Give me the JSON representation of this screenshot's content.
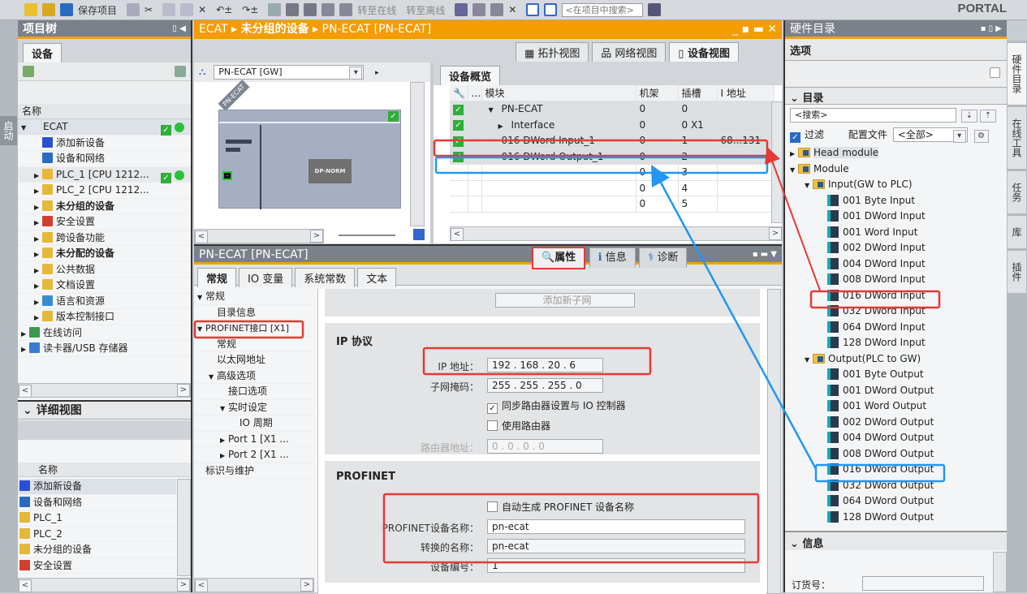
{
  "toolbar": {
    "save_label": "保存项目",
    "go_online": "转至在线",
    "go_offline": "转至离线",
    "search_placeholder": "<在项目中搜索>",
    "brand": "PORTAL"
  },
  "left_strip": {
    "label": "启动"
  },
  "project_tree": {
    "title": "项目树",
    "tab": "设备",
    "col_name": "名称",
    "items": [
      {
        "label": "ECAT",
        "level": 0,
        "fold": "▼",
        "bold": false,
        "check": true,
        "icon": "project-icon"
      },
      {
        "label": "添加新设备",
        "level": 1,
        "fold": "",
        "icon": "add-device-icon"
      },
      {
        "label": "设备和网络",
        "level": 1,
        "fold": "",
        "icon": "network-icon"
      },
      {
        "label": "PLC_1 [CPU 1212...",
        "level": 1,
        "fold": "▶",
        "check": true,
        "icon": "plc-icon"
      },
      {
        "label": "PLC_2 [CPU 1212...",
        "level": 1,
        "fold": "▶",
        "icon": "plc-icon"
      },
      {
        "label": "未分组的设备",
        "level": 1,
        "fold": "▶",
        "bold": true,
        "icon": "ungrouped-devices-icon"
      },
      {
        "label": "安全设置",
        "level": 1,
        "fold": "▶",
        "icon": "security-icon"
      },
      {
        "label": "跨设备功能",
        "level": 1,
        "fold": "▶",
        "icon": "cross-device-icon"
      },
      {
        "label": "未分配的设备",
        "level": 1,
        "fold": "▶",
        "bold": true,
        "icon": "unassigned-devices-icon"
      },
      {
        "label": "公共数据",
        "level": 1,
        "fold": "▶",
        "icon": "common-data-icon"
      },
      {
        "label": "文档设置",
        "level": 1,
        "fold": "▶",
        "icon": "document-settings-icon"
      },
      {
        "label": "语言和资源",
        "level": 1,
        "fold": "▶",
        "icon": "language-icon"
      },
      {
        "label": "版本控制接口",
        "level": 1,
        "fold": "▶",
        "icon": "version-control-icon"
      },
      {
        "label": "在线访问",
        "level": 0,
        "fold": "▶",
        "icon": "online-access-icon"
      },
      {
        "label": "读卡器/USB 存储器",
        "level": 0,
        "fold": "▶",
        "icon": "card-reader-icon"
      }
    ]
  },
  "detail_view": {
    "title": "详细视图",
    "col_name": "名称",
    "items": [
      "添加新设备",
      "设备和网络",
      "PLC_1",
      "PLC_2",
      "未分组的设备",
      "安全设置"
    ]
  },
  "editor": {
    "breadcrumb": [
      "ECAT",
      "未分组的设备",
      "PN-ECAT [PN-ECAT]"
    ],
    "view_tabs": [
      "拓扑视图",
      "网络视图",
      "设备视图"
    ],
    "device_select": "PN-ECAT [GW]",
    "device_label": "PN-ECAT",
    "module_label": "DP-NORM",
    "overview_tab": "设备概览",
    "overview_cols": [
      "模块",
      "机架",
      "插槽",
      "I 地址"
    ],
    "overview_rows": [
      {
        "module": "PN-ECAT",
        "fold": "▼",
        "rack": "0",
        "slot": "0",
        "addr": "",
        "check": true
      },
      {
        "module": "Interface",
        "fold": "▶",
        "rack": "0",
        "slot": "0 X1",
        "addr": "",
        "check": true
      },
      {
        "module": "016 DWord Input_1",
        "fold": "",
        "rack": "0",
        "slot": "1",
        "addr": "68...131",
        "check": true
      },
      {
        "module": "016 DWord Output_1",
        "fold": "",
        "rack": "0",
        "slot": "2",
        "addr": "",
        "check": true
      },
      {
        "module": "",
        "fold": "",
        "rack": "0",
        "slot": "3",
        "addr": ""
      },
      {
        "module": "",
        "fold": "",
        "rack": "0",
        "slot": "4",
        "addr": ""
      },
      {
        "module": "",
        "fold": "",
        "rack": "0",
        "slot": "5",
        "addr": ""
      }
    ]
  },
  "properties": {
    "title": "PN-ECAT [PN-ECAT]",
    "tabs": [
      "属性",
      "信息",
      "诊断"
    ],
    "subtabs": [
      "常规",
      "IO 变量",
      "系统常数",
      "文本"
    ],
    "nav": [
      {
        "label": "常规",
        "level": 0,
        "fold": "▼"
      },
      {
        "label": "目录信息",
        "level": 1,
        "fold": ""
      },
      {
        "label": "PROFINET接口 [X1]",
        "level": 0,
        "fold": "▼"
      },
      {
        "label": "常规",
        "level": 1,
        "fold": ""
      },
      {
        "label": "以太网地址",
        "level": 1,
        "fold": ""
      },
      {
        "label": "高级选项",
        "level": 1,
        "fold": "▼"
      },
      {
        "label": "接口选项",
        "level": 2,
        "fold": ""
      },
      {
        "label": "实时设定",
        "level": 2,
        "fold": "▼"
      },
      {
        "label": "IO 周期",
        "level": 3,
        "fold": ""
      },
      {
        "label": "Port 1 [X1 ...",
        "level": 2,
        "fold": "▶"
      },
      {
        "label": "Port 2 [X1 ...",
        "level": 2,
        "fold": "▶"
      },
      {
        "label": "标识与维护",
        "level": 0,
        "fold": ""
      }
    ],
    "add_subnet": "添加新子网",
    "ip_section": "IP 协议",
    "ip_label": "IP 地址：",
    "ip_value": "192 . 168 . 20 . 6",
    "mask_label": "子网掩码：",
    "mask_value": "255 . 255 . 255 . 0",
    "sync_router": "同步路由器设置与 IO 控制器",
    "sync_router_checked": true,
    "use_router": "使用路由器",
    "use_router_checked": false,
    "router_label": "路由器地址：",
    "router_value": "0 . 0 . 0 . 0",
    "pn_section": "PROFINET",
    "auto_name": "自动生成 PROFINET 设备名称",
    "auto_name_checked": false,
    "pn_name_label": "PROFINET设备名称：",
    "pn_name_value": "pn-ecat",
    "conv_name_label": "转换的名称：",
    "conv_name_value": "pn-ecat",
    "dev_num_label": "设备编号：",
    "dev_num_value": "1"
  },
  "catalog": {
    "title": "硬件目录",
    "options": "选项",
    "section": "目录",
    "search_placeholder": "<搜索>",
    "filter": "过滤",
    "filter_checked": true,
    "profile_label": "配置文件",
    "profile_value": "<全部>",
    "tree": [
      {
        "label": "Head module",
        "level": 0,
        "fold": "▶",
        "type": "folder"
      },
      {
        "label": "Module",
        "level": 0,
        "fold": "▼",
        "type": "folder"
      },
      {
        "label": "Input(GW to PLC)",
        "level": 1,
        "fold": "▼",
        "type": "folder"
      },
      {
        "label": "001 Byte Input",
        "level": 2,
        "type": "module"
      },
      {
        "label": "001 DWord Input",
        "level": 2,
        "type": "module"
      },
      {
        "label": "001 Word Input",
        "level": 2,
        "type": "module"
      },
      {
        "label": "002 DWord Input",
        "level": 2,
        "type": "module"
      },
      {
        "label": "004 DWord Input",
        "level": 2,
        "type": "module"
      },
      {
        "label": "008 DWord Input",
        "level": 2,
        "type": "module"
      },
      {
        "label": "016 DWord Input",
        "level": 2,
        "type": "module"
      },
      {
        "label": "032 DWord Input",
        "level": 2,
        "type": "module"
      },
      {
        "label": "064 DWord Input",
        "level": 2,
        "type": "module"
      },
      {
        "label": "128 DWord Input",
        "level": 2,
        "type": "module"
      },
      {
        "label": "Output(PLC to GW)",
        "level": 1,
        "fold": "▼",
        "type": "folder"
      },
      {
        "label": "001 Byte Output",
        "level": 2,
        "type": "module"
      },
      {
        "label": "001 DWord Output",
        "level": 2,
        "type": "module"
      },
      {
        "label": "001 Word Output",
        "level": 2,
        "type": "module"
      },
      {
        "label": "002 DWord Output",
        "level": 2,
        "type": "module"
      },
      {
        "label": "004 DWord Output",
        "level": 2,
        "type": "module"
      },
      {
        "label": "008 DWord Output",
        "level": 2,
        "type": "module"
      },
      {
        "label": "016 DWord Output",
        "level": 2,
        "type": "module"
      },
      {
        "label": "032 DWord Output",
        "level": 2,
        "type": "module"
      },
      {
        "label": "064 DWord Output",
        "level": 2,
        "type": "module"
      },
      {
        "label": "128 DWord Output",
        "level": 2,
        "type": "module"
      }
    ],
    "info_title": "信息",
    "order_label": "订货号："
  },
  "side_tabs": [
    "硬件目录",
    "在线工具",
    "任务",
    "库",
    "插件"
  ],
  "colors": {
    "accent": "#f59c00",
    "highlight_red": "#e53935",
    "highlight_blue": "#2196f3",
    "ok_green": "#2fae3a"
  }
}
